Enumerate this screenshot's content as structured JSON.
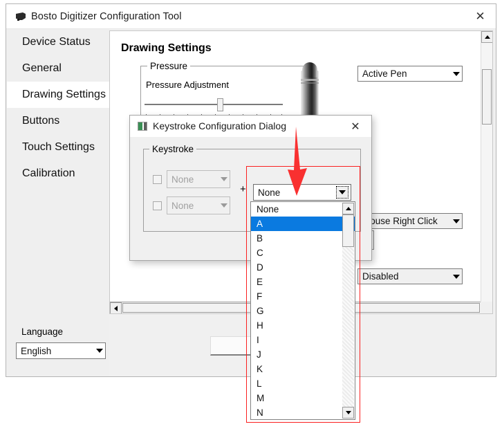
{
  "window": {
    "title": "Bosto Digitizer Configuration Tool",
    "app_icon": "tablet-icon",
    "close_label": "✕"
  },
  "sidebar": {
    "items": [
      {
        "label": "Device Status",
        "selected": false
      },
      {
        "label": "General",
        "selected": false
      },
      {
        "label": "Drawing Settings",
        "selected": true
      },
      {
        "label": "Buttons",
        "selected": false
      },
      {
        "label": "Touch Settings",
        "selected": false
      },
      {
        "label": "Calibration",
        "selected": false
      }
    ]
  },
  "main": {
    "page_title": "Drawing Settings",
    "pressure_group": {
      "legend": "Pressure",
      "slider_label": "Pressure Adjustment",
      "slider_value": 5,
      "slider_min": 0,
      "slider_max": 10,
      "tick_count": 11
    },
    "pen_image_alt": "stylus-pen",
    "combos": [
      {
        "name": "pen-mode",
        "value": "Active Pen"
      },
      {
        "name": "pen-button-upper",
        "value": "Mouse Right Click"
      },
      {
        "name": "pen-button-lower",
        "value": "Disabled"
      }
    ]
  },
  "footer": {
    "language_label": "Language",
    "language_value": "English"
  },
  "dialog": {
    "title": "Keystroke Configuration Dialog",
    "icon": "dialog-icon",
    "close_label": "✕",
    "group_legend": "Keystroke",
    "modifier_rows": [
      {
        "checked": false,
        "value": "None"
      },
      {
        "checked": false,
        "value": "None"
      }
    ],
    "plus": "+",
    "key_combo_value": "None"
  },
  "dropdown": {
    "items": [
      "None",
      "A",
      "B",
      "C",
      "D",
      "E",
      "F",
      "G",
      "H",
      "I",
      "J",
      "K",
      "L",
      "M",
      "N"
    ],
    "highlighted_index": 1,
    "scroll_up_icon": "scroll-up-icon",
    "scroll_down_icon": "scroll-down-icon"
  },
  "annotations": {
    "highlight_color": "#fb1f1f",
    "arrow": "down-arrow-annotation",
    "box": "dropdown-highlight-box"
  },
  "colors": {
    "selection_blue": "#0a7ae0",
    "window_bg": "#f0f0f0",
    "panel_bg": "#ffffff",
    "annotation_red": "#fb1f1f"
  }
}
